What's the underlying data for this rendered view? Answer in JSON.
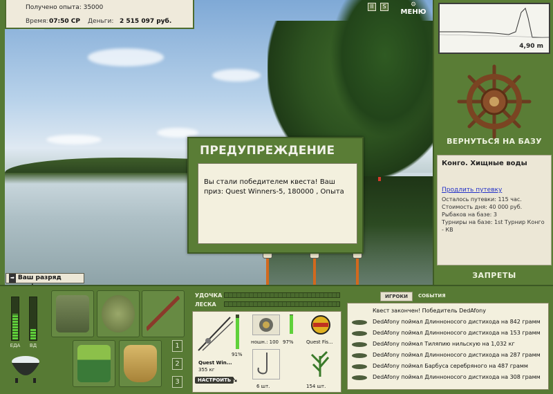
{
  "status": {
    "experience_text": "Получено опыта: 35000",
    "time_label": "Время:",
    "time_value": "07:50 СР",
    "money_label": "Деньги:",
    "money_value": "2 515 097 руб."
  },
  "top_buttons": {
    "pause": "II",
    "sound": "S",
    "menu": "МЕНЮ"
  },
  "sonar": {
    "depth": "4,90 m"
  },
  "right_panel": {
    "home_button": "ВЕРНУТЬСЯ НА БАЗУ",
    "location_title": "Конго. Хищные воды",
    "extend_link": "Продлить путевку",
    "days_left": "Осталось путевки: 115 час.",
    "day_cost": "Стоимость дня: 40 000 руб.",
    "fishers": "Рыбаков на базе: 3",
    "tournaments": "Турниры на базе: 1st Турнир Конго - КВ",
    "bans_button": "ЗАПРЕТЫ"
  },
  "dialog": {
    "title": "ПРЕДУПРЕЖДЕНИЕ",
    "message": "Вы стали победителем квеста! Ваш приз: Quest Winners-5, 180000 , Опыта"
  },
  "rank_message": "Ваш разряд вырос!",
  "meters": {
    "food_label": "ЕДА",
    "vd_label": "ВД",
    "food_level": 0.6,
    "vd_level": 0.25
  },
  "inventory_pages": [
    "1",
    "2",
    "3"
  ],
  "tackle": {
    "rod_label": "УДОЧКА",
    "line_label": "ЛЕСКА",
    "rod_percent": "91%",
    "rod_name": "Quest Win...",
    "rod_weight": "355 кг",
    "reel_info": "ношн.: 100",
    "reel_percent": "97%",
    "lure_name": "Quest Fis...",
    "hooks_count": "6 шт.",
    "bait_count": "154 шт.",
    "setup_button": "НАСТРОИТЬ",
    "rod_level": 0.91,
    "reel_level": 0.97
  },
  "events": {
    "tab_players": "ИГРОКИ",
    "tab_events": "СОБЫТИЯ",
    "lines": [
      "Квест закончен! Победитель DedAfony",
      "DedAfony поймал Длинноносого дистихода на 842 грамм",
      "DedAfony поймал Длинноносого дистихода на 153 грамм",
      "DedAfony поймал Тиляпию нильскую на 1,032 кг",
      "DedAfony поймал Длинноносого дистихода на 287 грамм",
      "DedAfony поймал Барбуса серебряного на 487 грамм",
      "DedAfony поймал Длинноносого дистихода на 308 грамм"
    ]
  }
}
